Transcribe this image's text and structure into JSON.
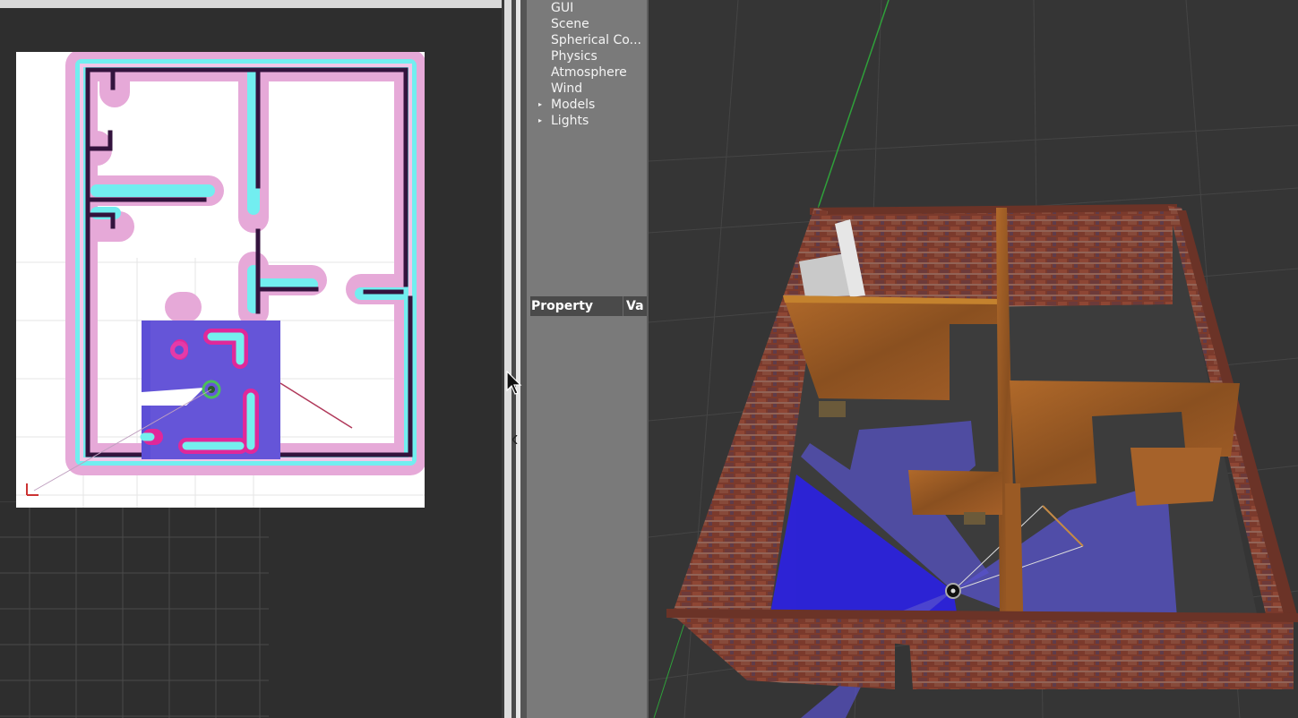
{
  "rviz": {
    "panel": "map-view"
  },
  "gazebo": {
    "world_tree": {
      "items": [
        {
          "label": "GUI",
          "expandable": false
        },
        {
          "label": "Scene",
          "expandable": false
        },
        {
          "label": "Spherical Co...",
          "expandable": false
        },
        {
          "label": "Physics",
          "expandable": false
        },
        {
          "label": "Atmosphere",
          "expandable": false
        },
        {
          "label": "Wind",
          "expandable": false
        },
        {
          "label": "Models",
          "expandable": true
        },
        {
          "label": "Lights",
          "expandable": true
        }
      ]
    },
    "property_table": {
      "property_header": "Property",
      "value_header": "Va"
    },
    "arrow_glyph": "▸"
  },
  "colors": {
    "background": "#2b2b2b",
    "panel_gray": "#7a7a7a",
    "scan_blue": "#2a22d8",
    "brick": "#7a3a2e",
    "wood": "#9a5a24",
    "inflation_cyan": "#6ff0f0",
    "inflation_pink": "#e8a8d8"
  }
}
